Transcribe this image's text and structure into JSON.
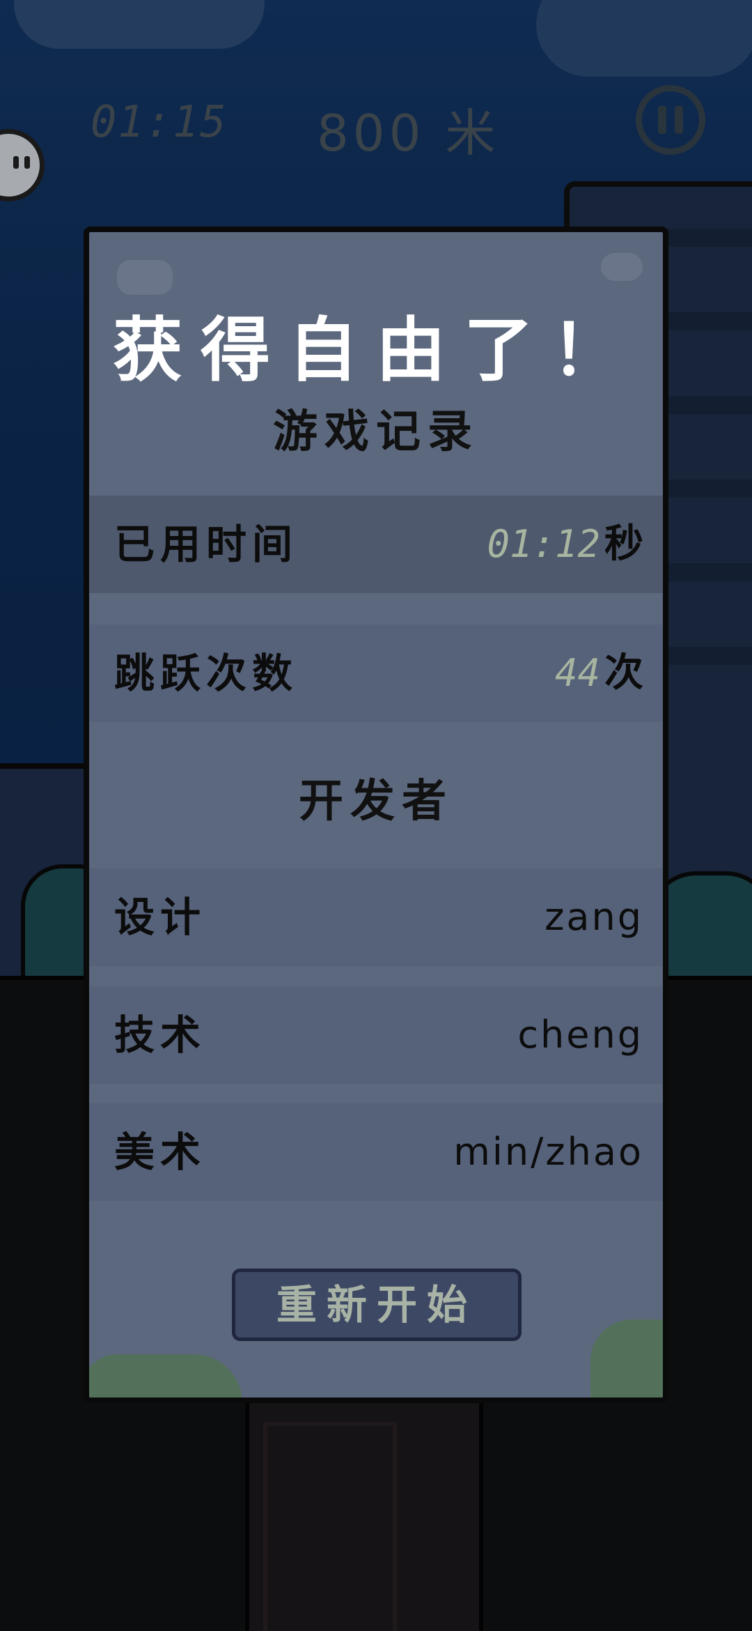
{
  "hud": {
    "time": "01:15",
    "distance": "800 米",
    "pause_icon": "pause-icon",
    "avatar_icon": "character-face-icon"
  },
  "panel": {
    "title": "获得自由了！",
    "record_heading": "游戏记录",
    "stats": [
      {
        "label": "已用时间",
        "value": "01:12",
        "unit": "秒"
      },
      {
        "label": "跳跃次数",
        "value": "44",
        "unit": "次"
      }
    ],
    "developer_heading": "开发者",
    "developers": [
      {
        "label": "设计",
        "value": "zang"
      },
      {
        "label": "技术",
        "value": "cheng"
      },
      {
        "label": "美术",
        "value": "min/zhao"
      }
    ],
    "restart_label": "重新开始"
  },
  "colors": {
    "panel_bg": "#5c687e",
    "row_bg": "#4e596d",
    "stat_number": "#a8b5a0",
    "button_bg": "#3d4864",
    "button_text": "#a8b3a6"
  }
}
